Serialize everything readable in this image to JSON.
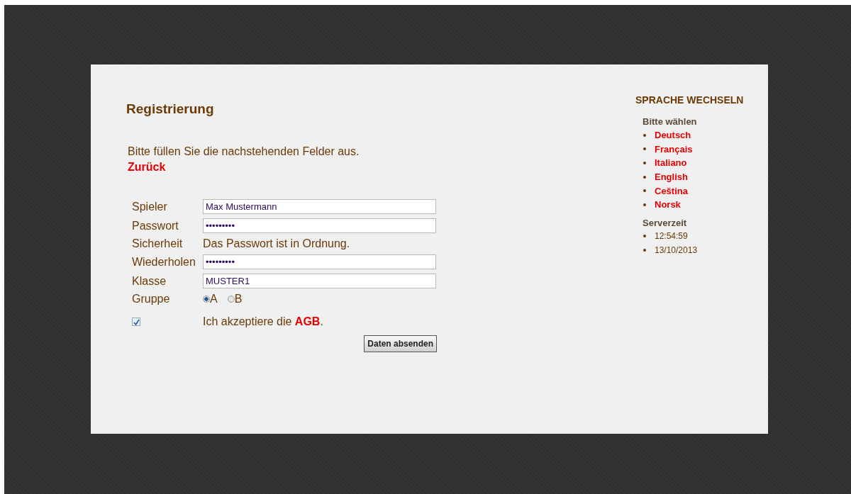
{
  "registration": {
    "title": "Registrierung",
    "intro": "Bitte füllen Sie die nachstehenden Felder aus.",
    "back_link": "Zurück",
    "fields": [
      {
        "kind": "input",
        "label": "Spieler",
        "value": "Max Mustermann"
      },
      {
        "kind": "input",
        "label": "Passwort",
        "value": "•••••••••"
      },
      {
        "kind": "text",
        "label": "Sicherheit",
        "value": "Das Passwort ist in Ordnung."
      },
      {
        "kind": "input",
        "label": "Wiederholen",
        "value": "•••••••••"
      },
      {
        "kind": "input",
        "label": "Klasse",
        "value": "MUSTER1"
      },
      {
        "kind": "radio",
        "label": "Gruppe",
        "options": [
          {
            "label": "A",
            "selected": true
          },
          {
            "label": "B",
            "selected": false
          }
        ]
      }
    ],
    "terms": {
      "checked": true,
      "text": "Ich akzeptiere die **AGB**."
    },
    "submit": "Daten absenden"
  },
  "sidebar": {
    "title": "SPRACHE WECHSELN",
    "language_heading": "Bitte wählen",
    "languages": [
      "Deutsch",
      "Français",
      "Italiano",
      "English",
      "Ceština",
      "Norsk"
    ],
    "server_heading": "Serverzeit",
    "server_time": [
      "12:54:59",
      "13/10/2013"
    ]
  }
}
